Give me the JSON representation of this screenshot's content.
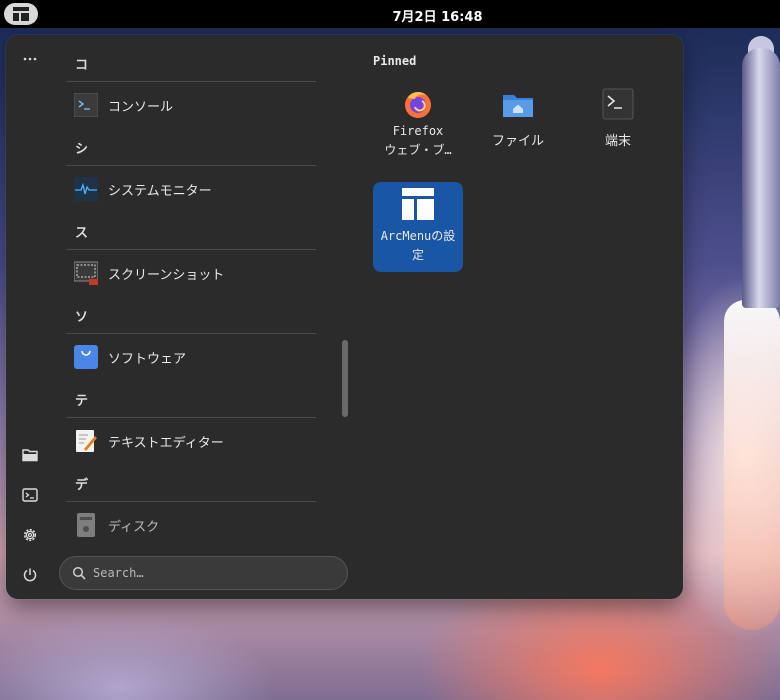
{
  "topbar": {
    "clock": "7月2日 16:48",
    "activities_icon": "arcmenu-icon"
  },
  "menu": {
    "side_buttons": [
      {
        "name": "more-options-button",
        "icon": "ellipsis-icon"
      },
      {
        "name": "files-shortcut-button",
        "icon": "folder-icon"
      },
      {
        "name": "terminal-shortcut-button",
        "icon": "terminal-icon"
      },
      {
        "name": "settings-shortcut-button",
        "icon": "gear-icon"
      },
      {
        "name": "power-button",
        "icon": "power-icon"
      }
    ],
    "app_list": [
      {
        "type": "section",
        "label": "コ"
      },
      {
        "type": "app",
        "label": "コンソール",
        "icon": "console-icon"
      },
      {
        "type": "section",
        "label": "シ"
      },
      {
        "type": "app",
        "label": "システムモニター",
        "icon": "system-monitor-icon"
      },
      {
        "type": "section",
        "label": "ス"
      },
      {
        "type": "app",
        "label": "スクリーンショット",
        "icon": "screenshot-icon"
      },
      {
        "type": "section",
        "label": "ソ"
      },
      {
        "type": "app",
        "label": "ソフトウェア",
        "icon": "software-icon"
      },
      {
        "type": "section",
        "label": "テ"
      },
      {
        "type": "app",
        "label": "テキストエディター",
        "icon": "text-editor-icon"
      },
      {
        "type": "section",
        "label": "デ"
      },
      {
        "type": "app",
        "label": "ディスク",
        "icon": "disk-icon"
      }
    ],
    "search": {
      "placeholder": "Search…"
    },
    "pinned": {
      "title": "Pinned",
      "items": [
        {
          "line1": "Firefox",
          "line2": "ウェブ・ブ…",
          "icon": "firefox-icon",
          "selected": false
        },
        {
          "line1": "ファイル",
          "line2": "",
          "icon": "folder-home-icon",
          "selected": false
        },
        {
          "line1": "端末",
          "line2": "",
          "icon": "terminal-icon",
          "selected": false
        },
        {
          "line1": "ArcMenuの設",
          "line2": "定",
          "icon": "arcmenu-settings-icon",
          "selected": true
        }
      ]
    }
  },
  "colors": {
    "panel": "#2b2b2b",
    "selected_tile": "#1a56a6",
    "topbar": "#000000"
  }
}
